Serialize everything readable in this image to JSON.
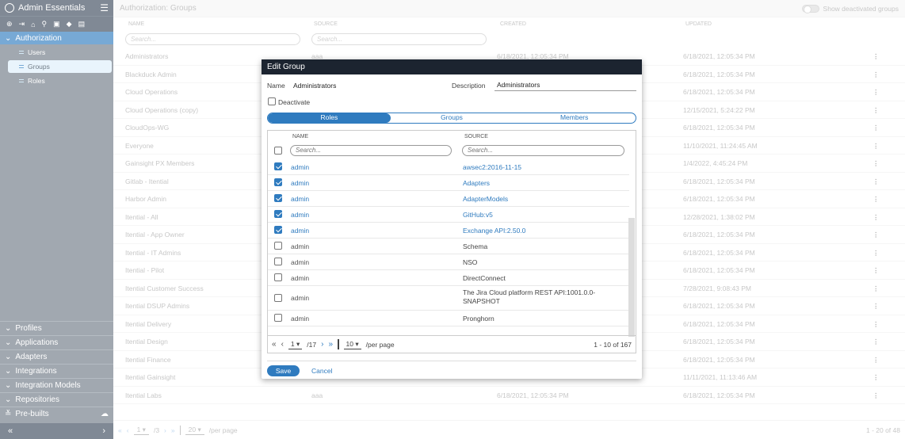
{
  "sidebar": {
    "title": "Admin Essentials",
    "section_active": "Authorization",
    "items": [
      {
        "label": "Users"
      },
      {
        "label": "Groups"
      },
      {
        "label": "Roles"
      }
    ],
    "sections": [
      "Profiles",
      "Applications",
      "Adapters",
      "Integrations",
      "Integration Models",
      "Repositories",
      "Pre-builts"
    ],
    "tool_icons": [
      "add-icon",
      "import-icon",
      "home-icon",
      "search-icon",
      "briefcase-icon",
      "tag-icon",
      "document-icon"
    ],
    "footer_left": "«",
    "footer_right": "›"
  },
  "main": {
    "page_title": "Authorization: Groups",
    "toggle_label": "Show deactivated groups",
    "columns": [
      "NAME",
      "SOURCE",
      "CREATED",
      "UPDATED"
    ],
    "search_placeholder": "Search...",
    "rows": [
      {
        "name": "Administrators",
        "source": "aaa",
        "created": "6/18/2021, 12:05:34 PM",
        "updated": "6/18/2021, 12:05:34 PM"
      },
      {
        "name": "Blackduck Admin",
        "source": "",
        "created": "",
        "updated": "6/18/2021, 12:05:34 PM"
      },
      {
        "name": "Cloud Operations",
        "source": "",
        "created": "",
        "updated": "6/18/2021, 12:05:34 PM"
      },
      {
        "name": "Cloud Operations (copy)",
        "source": "",
        "created": "",
        "updated": "12/15/2021, 5:24:22 PM"
      },
      {
        "name": "CloudOps-WG",
        "source": "",
        "created": "",
        "updated": "6/18/2021, 12:05:34 PM"
      },
      {
        "name": "Everyone",
        "source": "",
        "created": "",
        "updated": "11/10/2021, 11:24:45 AM"
      },
      {
        "name": "Gainsight PX Members",
        "source": "",
        "created": "",
        "updated": "1/4/2022, 4:45:24 PM"
      },
      {
        "name": "Gitlab - Itential",
        "source": "",
        "created": "",
        "updated": "6/18/2021, 12:05:34 PM"
      },
      {
        "name": "Harbor Admin",
        "source": "",
        "created": "",
        "updated": "6/18/2021, 12:05:34 PM"
      },
      {
        "name": "Itential - All",
        "source": "",
        "created": "",
        "updated": "12/28/2021, 1:38:02 PM"
      },
      {
        "name": "Itential - App Owner",
        "source": "",
        "created": "",
        "updated": "6/18/2021, 12:05:34 PM"
      },
      {
        "name": "Itential - IT Admins",
        "source": "",
        "created": "",
        "updated": "6/18/2021, 12:05:34 PM"
      },
      {
        "name": "Itential - Pilot",
        "source": "",
        "created": "",
        "updated": "6/18/2021, 12:05:34 PM"
      },
      {
        "name": "Itential Customer Success",
        "source": "",
        "created": "",
        "updated": "7/28/2021, 9:08:43 PM"
      },
      {
        "name": "Itential DSUP Admins",
        "source": "",
        "created": "",
        "updated": "6/18/2021, 12:05:34 PM"
      },
      {
        "name": "Itential Delivery",
        "source": "",
        "created": "",
        "updated": "6/18/2021, 12:05:34 PM"
      },
      {
        "name": "Itential Design",
        "source": "",
        "created": "",
        "updated": "6/18/2021, 12:05:34 PM"
      },
      {
        "name": "Itential Finance",
        "source": "",
        "created": "",
        "updated": "6/18/2021, 12:05:34 PM"
      },
      {
        "name": "Itential Gainsight",
        "source": "",
        "created": "",
        "updated": "11/11/2021, 11:13:46 AM"
      },
      {
        "name": "Itential Labs",
        "source": "aaa",
        "created": "6/18/2021, 12:05:34 PM",
        "updated": "6/18/2021, 12:05:34 PM"
      }
    ],
    "pagination": {
      "page": "1",
      "of": "/3",
      "per_page": "20",
      "per_page_label": "/per page",
      "total": "1 - 20 of 48"
    }
  },
  "modal": {
    "title": "Edit Group",
    "name_label": "Name",
    "name_value": "Administrators",
    "description_label": "Description",
    "description_value": "Administrators",
    "deactivate_label": "Deactivate",
    "tabs": [
      "Roles",
      "Groups",
      "Members"
    ],
    "grid_columns": [
      "NAME",
      "SOURCE"
    ],
    "search_placeholder": "Search...",
    "roles": [
      {
        "name": "admin",
        "source": "awsec2:2016-11-15",
        "checked": true
      },
      {
        "name": "admin",
        "source": "Adapters",
        "checked": true
      },
      {
        "name": "admin",
        "source": "AdapterModels",
        "checked": true
      },
      {
        "name": "admin",
        "source": "GitHub:v5",
        "checked": true
      },
      {
        "name": "admin",
        "source": "Exchange API:2.50.0",
        "checked": true
      },
      {
        "name": "admin",
        "source": "Schema",
        "checked": false
      },
      {
        "name": "admin",
        "source": "NSO",
        "checked": false
      },
      {
        "name": "admin",
        "source": "DirectConnect",
        "checked": false
      },
      {
        "name": "admin",
        "source": "The Jira Cloud platform REST API:1001.0.0-SNAPSHOT",
        "checked": false
      },
      {
        "name": "admin",
        "source": "Pronghorn",
        "checked": false
      }
    ],
    "pagination": {
      "page": "1",
      "of": "/17",
      "per_page": "10",
      "per_page_label": "/per page",
      "total": "1 - 10 of 167"
    },
    "save_label": "Save",
    "cancel_label": "Cancel"
  },
  "colors": {
    "accent": "#2f7bbf",
    "sidebar": "#6f7a86",
    "sidebar_dark": "#3c4b5c",
    "modal_header": "#1c2430"
  }
}
